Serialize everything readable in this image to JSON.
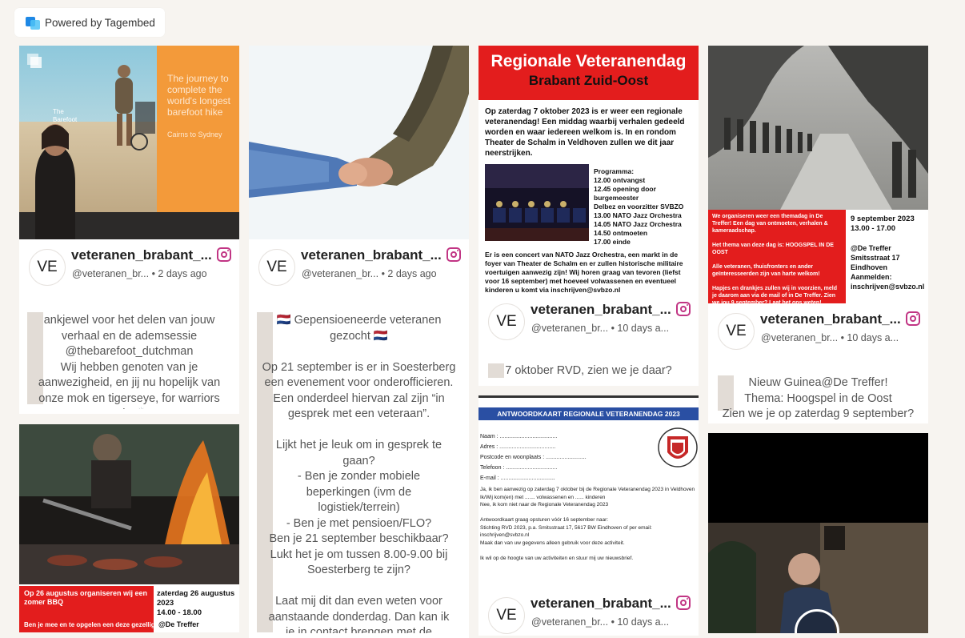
{
  "badge": {
    "label": "Powered by Tagembed"
  },
  "account": {
    "initials": "VE",
    "username": "veteranen_brabant_...",
    "handle_short": "@veteranen_br..."
  },
  "cards": {
    "c1": {
      "time": "• 2 days ago",
      "caption": "ankjewel voor het delen van jouw\nverhaal en de ademsessie\n@thebarefoot_dutchman\nWij hebben genoten van je\naanwezigheid, en jij nu hopelijk van\nonze mok en tigerseye, for warriors\nonly 🙌🏽",
      "slide": {
        "line1": "The journey to",
        "line2": "complete the",
        "line3": "world's longest",
        "line4": "barefoot hike",
        "route": "Cairns to Sydney",
        "logo": "The Barefoot"
      }
    },
    "c2": {
      "time": "• 2 days ago",
      "caption": "🇳🇱 Gepensioeneerde veteranen\ngezocht 🇳🇱\n\nOp 21 september is er in Soesterberg\neen evenement voor onderofficieren.\nEen onderdeel hiervan zal zijn “in\ngesprek met een veteraan”.\n\nLijkt het je leuk om in gesprek te\ngaan?\n- Ben je zonder mobiele\nbeperkingen (ivm de\nlogistiek/terrein)\n- Ben je met pensioen/FLO?\nBen je 21 september beschikbaar?\nLukt het je om tussen 8.00-9.00 bij\nSoesterberg te zijn?\n\nLaat mij dit dan even weten voor\naanstaande donderdag. Dan kan ik\nje in contact brengen met de\naanvrager! Heb je hier vragen over,\nmag je uiteraard ook een berichtje\nsturen of reageren of mailen naar"
    },
    "c3": {
      "time": "• 10 days a...",
      "caption": "7 oktober RVD, zien we je daar?",
      "poster": {
        "title1": "Regionale Veteranendag",
        "title2": "Brabant Zuid-Oost",
        "intro": "Op zaterdag 7 oktober 2023 is er weer een regionale veteranendag! Een middag waarbij verhalen gedeeld worden en waar iedereen welkom is. In en rondom Theater de Schalm in Veldhoven zullen we dit jaar neerstrijken.",
        "programma": "Programma:\n12.00 ontvangst\n12.45 opening door burgemeester\nDelbez en voorzitter SVBZO\n13.00 NATO Jazz Orchestra\n14.05 NATO Jazz Orchestra\n14.50 ontmoeten\n17.00 einde",
        "footer": "Er is een concert van NATO Jazz Orchestra, een markt in de foyer van Theater de Schalm en er zullen historische militaire voertuigen aanwezig zijn! Wij horen graag van tevoren (liefst voor 16 september) met hoeveel volwassenen en eventueel kinderen u komt via inschrijven@svbzo.nl"
      }
    },
    "c4": {
      "time": "• 10 days a...",
      "caption": "Nieuw Guinea@De Treffer!\nThema: Hoogspel in de Oost\nZien we je op zaterdag 9 september?",
      "poster": {
        "left": "We organiseren weer een themadag in De Treffer! Een dag van ontmoeten, verhalen & kameraadschap.\n\nHet thema van deze dag is: HOOGSPEL IN DE OOST\n\nAlle veteranen, thuisfronters en ander geïnteresseerden zijn van harte welkom!\n\nHapjes en drankjes zullen wij in voorzien, meld je daarom aan via de mail of in De Treffer. Zien we jou 9 september? Laat het ons weten!",
        "date": "9 september 2023\n13.00 - 17.00",
        "place": "@De Treffer\nSmitsstraat 17 Eindhoven",
        "signup": "Aanmelden:\ninschrijven@svbzo.nl"
      }
    },
    "c5": {
      "poster": {
        "left": "Op 26 augustus organiseren wij een zomer BBQ",
        "right": "zaterdag 26 augustus 2023\n14.00 - 18.00",
        "left2": "Ben je mee en te opgelen een deze gezellige",
        "right2": "@De Treffer"
      }
    },
    "c6": {
      "time": "• 10 days a...",
      "form": {
        "header": "ANTWOORDKAART REGIONALE VETERANENDAG 2023",
        "lines": "Naam : .....................................\nAdres : ....................................\nPostcode en woonplaats : ..........................\nTelefoon : .................................\nE-mail : ...................................",
        "body": "Ja, ik ben aanwezig op zaterdag 7 oktober bij de Regionale Veteranendag 2023 in Veldhoven\nIk/Wij kom(en) met ....... volwassenen en ...... kinderen\nNee, ik kom niet naar de Regionale Veteranendag 2023\n\nAntwoordkaart graag opsturen vóór 16 september naar:\nStichting RVD 2023, p.a. Smitsstraat 17, 5617 BW Eindhoven of per email: inschrijven@svbzo.nl\nMaak dan van uw gegevens alleen gebruik voor deze activiteit.\n\nIk wil op de hoogte van uw activiteiten en stuur mij uw nieuwsbrief."
      }
    }
  },
  "colors": {
    "instagram": "#c13584",
    "poster_red": "#e31d1d",
    "tagembed_blue": "#1e88e5"
  }
}
